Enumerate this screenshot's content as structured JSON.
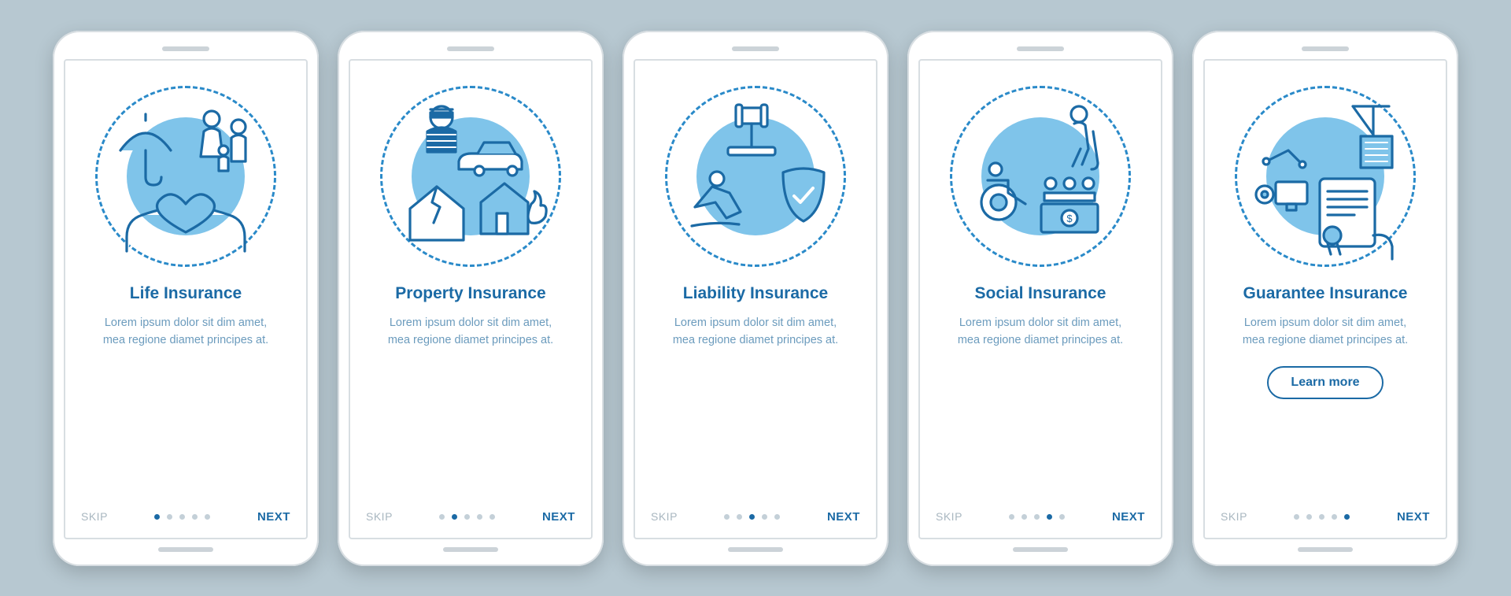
{
  "nav": {
    "skip": "SKIP",
    "next": "NEXT"
  },
  "learn_more": "Learn more",
  "body_text": "Lorem ipsum dolor sit dim amet, mea regione diamet principes at.",
  "screens": [
    {
      "title": "Life Insurance",
      "has_button": false,
      "dots_total": 5,
      "active_dot": 0
    },
    {
      "title": "Property Insurance",
      "has_button": false,
      "dots_total": 5,
      "active_dot": 1
    },
    {
      "title": "Liability Insurance",
      "has_button": false,
      "dots_total": 5,
      "active_dot": 2
    },
    {
      "title": "Social Insurance",
      "has_button": false,
      "dots_total": 5,
      "active_dot": 3
    },
    {
      "title": "Guarantee Insurance",
      "has_button": true,
      "dots_total": 5,
      "active_dot": 4
    }
  ],
  "colors": {
    "primary": "#1b6aa5",
    "accent": "#2a8ac9",
    "fill": "#7fc4ea",
    "muted": "#a9b7c0",
    "bg": "#b7c8d1"
  }
}
